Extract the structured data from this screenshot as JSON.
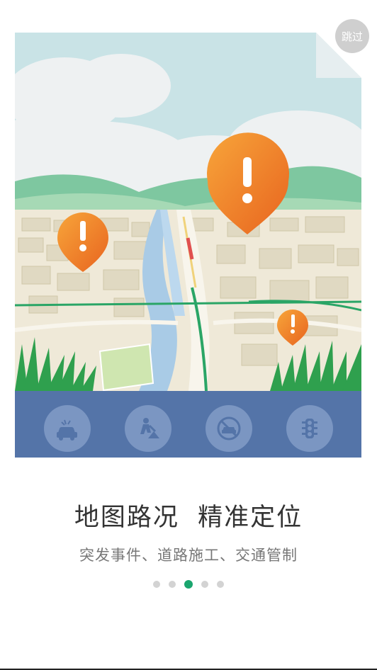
{
  "skip_label": "跳过",
  "title": "地图路况  精准定位",
  "subtitle": "突发事件、道路施工、交通管制",
  "pager": {
    "count": 5,
    "active_index": 2
  },
  "bar_icons": [
    "car-accident-icon",
    "road-construction-icon",
    "no-vehicle-icon",
    "traffic-light-icon"
  ],
  "colors": {
    "sky": "#c9e3e6",
    "icon_bar": "#5474a8",
    "icon_circle": "#7b96c2",
    "alert_pin": "#f0822a",
    "active_dot": "#1aa56e",
    "inactive_dot": "#d3d3d3",
    "river": "#a9cbe6",
    "road_green": "#2aa566",
    "grass": "#2fa04e"
  }
}
